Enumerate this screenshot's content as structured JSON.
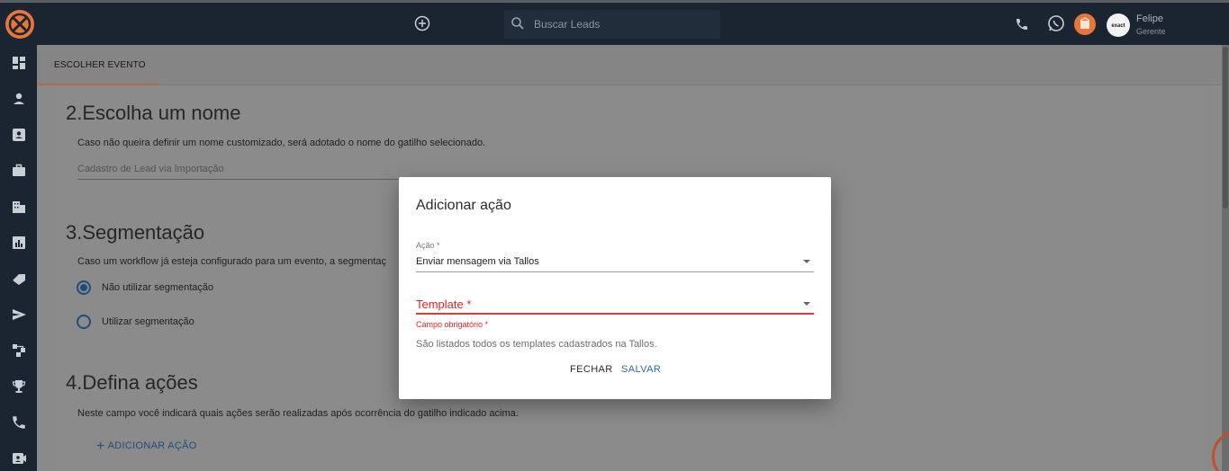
{
  "header": {
    "search_placeholder": "Buscar Leads",
    "user_name": "Felipe",
    "user_role": "Gerente",
    "avatar_text": "exact"
  },
  "sidebar": {
    "icons": [
      "dashboard-icon",
      "person-icon",
      "contact-card-icon",
      "briefcase-icon",
      "building-icon",
      "bar-chart-icon",
      "tag-icon",
      "send-icon",
      "workflow-icon",
      "trophy-icon",
      "phone-icon",
      "video-icon"
    ]
  },
  "tabs": {
    "active": "ESCOLHER EVENTO"
  },
  "sections": {
    "name": {
      "title": "2.Escolha um nome",
      "description": "Caso não queira definir um nome customizado, será adotado o nome do gatilho selecionado.",
      "placeholder": "Cadastro de Lead via Importação"
    },
    "segmentation": {
      "title": "3.Segmentação",
      "description": "Caso um workflow já esteja configurado para um evento, a segmentaç",
      "option_no": "Não utilizar segmentação",
      "option_yes": "Utilizar segmentação",
      "selected": "Não utilizar segmentação"
    },
    "actions": {
      "title": "4.Defina ações",
      "description": "Neste campo você indicará quais ações serão realizadas após ocorrência do gatilho indicado acima.",
      "add_label": "ADICIONAR AÇÃO"
    }
  },
  "modal": {
    "title": "Adicionar ação",
    "action_label": "Ação *",
    "action_value": "Enviar mensagem via Tallos",
    "template_label": "Template *",
    "template_error": "Campo obrigatório *",
    "template_help": "São listados todos os templates cadastrados na Tallos.",
    "close_label": "FECHAR",
    "save_label": "SALVAR"
  },
  "colors": {
    "header_bg": "#1b2532",
    "accent_orange": "#e8763a",
    "primary_blue": "#2f6aa2",
    "error_red": "#e02424"
  }
}
